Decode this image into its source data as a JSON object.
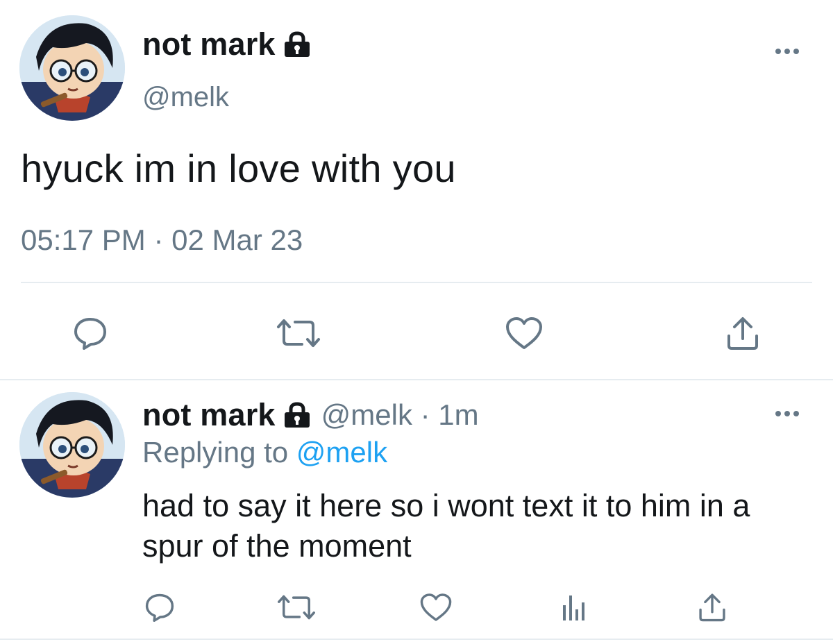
{
  "main_tweet": {
    "display_name": "not mark",
    "handle": "@melk",
    "text": "hyuck im in love with you",
    "timestamp": "05:17 PM · 02 Mar 23",
    "actions": [
      "reply-icon",
      "retweet-icon",
      "like-icon",
      "share-icon"
    ]
  },
  "reply_tweet": {
    "display_name": "not mark",
    "meta": "@melk · 1m",
    "replying_prefix": "Replying to",
    "replying_mention": "@melk",
    "text": "had to say it here so i wont text it to him in a spur of the moment",
    "actions": [
      "reply-icon",
      "retweet-icon",
      "like-icon",
      "analytics-icon",
      "share-icon"
    ]
  },
  "colors": {
    "text": "#14171a",
    "secondary": "#657786",
    "link": "#1da1f2",
    "divider": "#e6ecf0"
  }
}
